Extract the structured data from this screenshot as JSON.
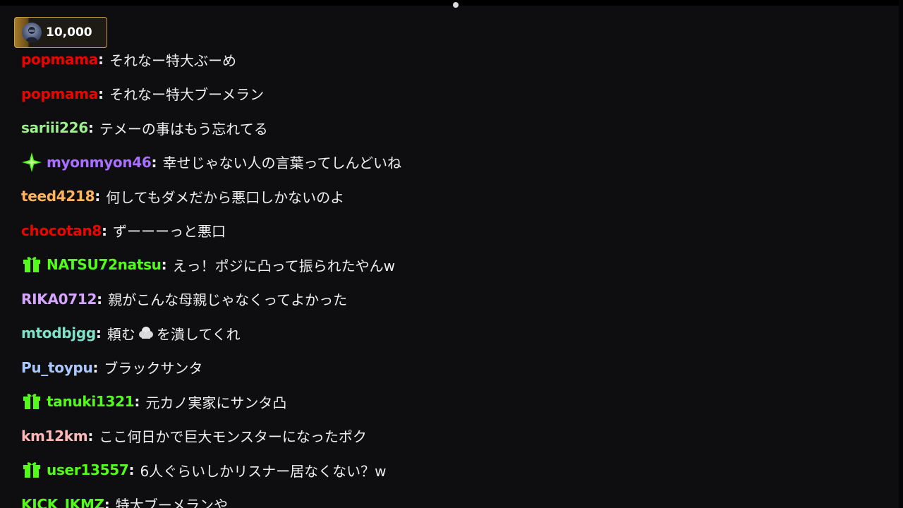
{
  "hype_chip": {
    "value": "10,000"
  },
  "messages": [
    {
      "user": "popmama",
      "color": "#eb0400",
      "badge": null,
      "text": "それなー特大ぶーめ"
    },
    {
      "user": "popmama",
      "color": "#eb0400",
      "badge": null,
      "text": "それなー特大ブーメラン"
    },
    {
      "user": "sariii226",
      "color": "#9bf08c",
      "badge": null,
      "text": "テメーの事はもう忘れてる"
    },
    {
      "user": "myonmyon46",
      "color": "#a970ff",
      "badge": "sparkle-badge-icon",
      "text": "幸せじゃない人の言葉ってしんどいね"
    },
    {
      "user": "teed4218",
      "color": "#ffb35c",
      "badge": null,
      "text": "何してもダメだから悪口しかないのよ"
    },
    {
      "user": "chocotan8",
      "color": "#eb0400",
      "badge": null,
      "text": "ずーーーっと悪口"
    },
    {
      "user": "NATSU72natsu",
      "color": "#53fc18",
      "badge": "gift-badge-icon",
      "text": "えっ！ポジに凸って振られたやんw"
    },
    {
      "user": "RIKA0712",
      "color": "#d6a6ff",
      "badge": null,
      "text": "親がこんな母親じゃなくってよかった"
    },
    {
      "user": "mtodbjgg",
      "color": "#7fe3c8",
      "badge": null,
      "text_before": "頼む",
      "emote": "cloud-emote-icon",
      "text": "を潰してくれ"
    },
    {
      "user": "Pu_toypu",
      "color": "#a8c8ff",
      "badge": null,
      "text": "ブラックサンタ"
    },
    {
      "user": "tanuki1321",
      "color": "#53fc18",
      "badge": "gift-badge-icon",
      "text": "元カノ実家にサンタ凸"
    },
    {
      "user": "km12km",
      "color": "#ffb8b8",
      "badge": null,
      "text": "ここ何日かで巨大モンスターになったポク"
    },
    {
      "user": "user13557",
      "color": "#53fc18",
      "badge": "gift-badge-icon",
      "text": "6人ぐらいしかリスナー居なくない？w"
    },
    {
      "user": "KICK_JKMZ",
      "color": "#53fc18",
      "badge": null,
      "text": "特大ブーメランや"
    }
  ]
}
